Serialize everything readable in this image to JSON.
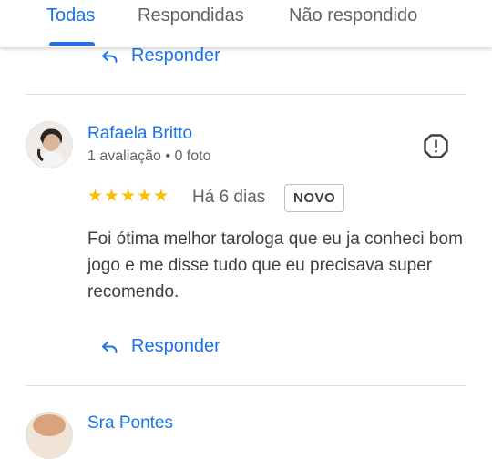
{
  "tabs": [
    {
      "label": "Todas",
      "active": true
    },
    {
      "label": "Respondidas",
      "active": false
    },
    {
      "label": "Não respondido",
      "active": false
    }
  ],
  "reply_label": "Responder",
  "review": {
    "name": "Rafaela Britto",
    "meta": "1 avaliação • 0 foto",
    "rating": 5,
    "date": "Há 6 dias",
    "badge": "NOVO",
    "text": "Foi ótima melhor tarologa que eu ja conheci bom jogo e me disse tudo que eu precisava super recomendo."
  },
  "next_review": {
    "name": "Sra Pontes"
  },
  "icons": {
    "reply": "reply-arrow-icon",
    "flag": "report-flag-icon",
    "star": "star-icon"
  },
  "colors": {
    "accent": "#1a73e8",
    "star": "#fbbc04",
    "text": "#3c4043",
    "secondary": "#5f6368"
  }
}
